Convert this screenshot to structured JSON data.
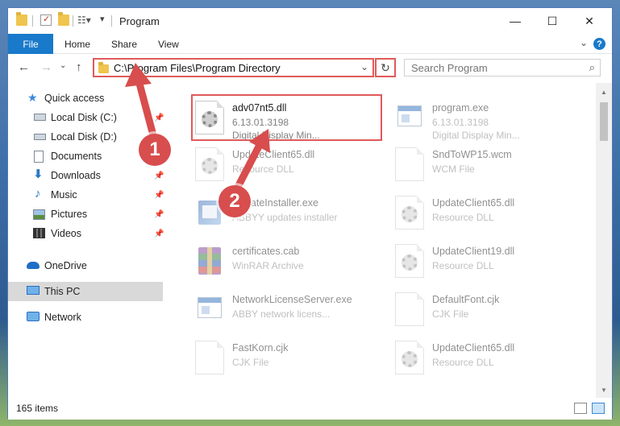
{
  "window": {
    "title": "Program"
  },
  "ribbon": {
    "file": "File",
    "home": "Home",
    "share": "Share",
    "view": "View",
    "help": "?"
  },
  "address": {
    "path": "C:\\Program Files\\Program Directory"
  },
  "search": {
    "placeholder": "Search Program"
  },
  "sidebar": {
    "items": [
      {
        "label": "Quick access",
        "icon": "star-icon"
      },
      {
        "label": "Local Disk (C:)",
        "icon": "drive-icon"
      },
      {
        "label": "Local Disk (D:)",
        "icon": "drive-icon"
      },
      {
        "label": "Documents",
        "icon": "documents-icon"
      },
      {
        "label": "Downloads",
        "icon": "download-arrow-icon"
      },
      {
        "label": "Music",
        "icon": "music-note-icon"
      },
      {
        "label": "Pictures",
        "icon": "pictures-icon"
      },
      {
        "label": "Videos",
        "icon": "film-icon"
      },
      {
        "label": "OneDrive",
        "icon": "cloud-icon"
      },
      {
        "label": "This PC",
        "icon": "monitor-icon"
      },
      {
        "label": "Network",
        "icon": "network-icon"
      }
    ]
  },
  "files": [
    {
      "name": "adv07nt5.dll",
      "line1": "6.13.01.3198",
      "line2": "Digital Display Min...",
      "icon": "gear-file-icon"
    },
    {
      "name": "program.exe",
      "line1": "6.13.01.3198",
      "line2": "Digital Display Min...",
      "icon": "exe-file-icon"
    },
    {
      "name": "UpdateClient65.dll",
      "line1": "Resource DLL",
      "icon": "gear-file-icon"
    },
    {
      "name": "SndToWP15.wcm",
      "line1": "WCM File",
      "icon": "blank-file-icon"
    },
    {
      "name": "UpdateInstaller.exe",
      "line1": "ABBYY updates installer",
      "icon": "installer-icon"
    },
    {
      "name": "UpdateClient65.dll",
      "line1": "Resource DLL",
      "icon": "gear-file-icon"
    },
    {
      "name": "certificates.cab",
      "line1": "WinRAR Archive",
      "icon": "winrar-archive-icon"
    },
    {
      "name": "UpdateClient19.dll",
      "line1": "Resource DLL",
      "icon": "gear-file-icon"
    },
    {
      "name": "NetworkLicenseServer.exe",
      "line1": "ABBY network licens...",
      "icon": "exe-file-icon"
    },
    {
      "name": "DefaultFont.cjk",
      "line1": "CJK File",
      "icon": "blank-file-icon"
    },
    {
      "name": "FastKorn.cjk",
      "line1": "CJK File",
      "icon": "blank-file-icon"
    },
    {
      "name": "UpdateClient65.dll",
      "line1": "Resource DLL",
      "icon": "gear-file-icon"
    }
  ],
  "status": {
    "count": "165 items"
  },
  "annotations": {
    "step1": "1",
    "step2": "2"
  },
  "colors": {
    "accent": "#1979ca",
    "annotation": "#d84d4d"
  }
}
